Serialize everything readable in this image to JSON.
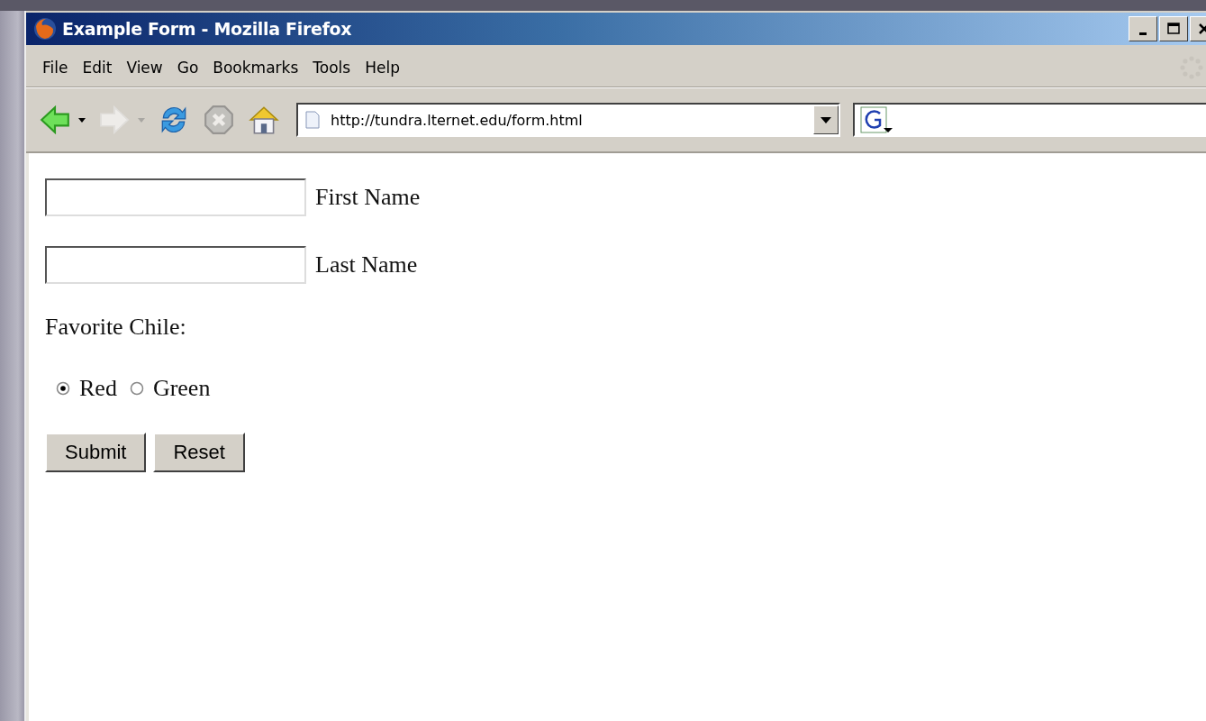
{
  "window": {
    "title": "Example Form - Mozilla Firefox"
  },
  "menu": [
    {
      "label": "File"
    },
    {
      "label": "Edit"
    },
    {
      "label": "View"
    },
    {
      "label": "Go"
    },
    {
      "label": "Bookmarks"
    },
    {
      "label": "Tools"
    },
    {
      "label": "Help"
    }
  ],
  "toolbar": [
    {
      "kind": "back",
      "disabled": false
    },
    {
      "kind": "forward",
      "disabled": true
    },
    {
      "kind": "reload",
      "disabled": false
    },
    {
      "kind": "stop",
      "disabled": true
    },
    {
      "kind": "home",
      "disabled": false
    }
  ],
  "address_bar": {
    "value": "http://tundra.lternet.edu/form.html"
  },
  "form": {
    "fields": [
      {
        "label": "First Name"
      },
      {
        "label": "Last Name"
      }
    ],
    "question": "Favorite Chile:",
    "options": [
      {
        "label": "Red",
        "selected": true
      },
      {
        "label": "Green",
        "selected": false
      }
    ],
    "buttons": [
      "Submit",
      "Reset"
    ]
  }
}
